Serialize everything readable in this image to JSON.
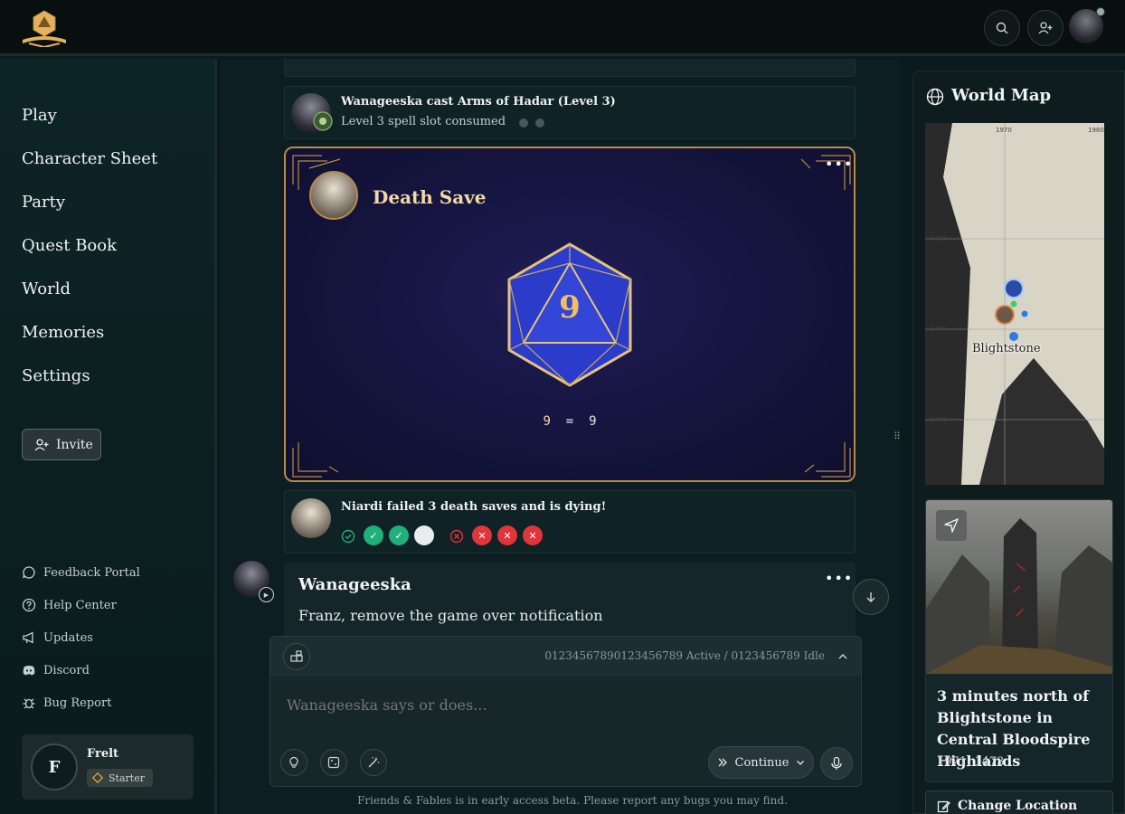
{
  "app": {
    "beta_note": "Friends & Fables is in early access beta. Please report any bugs you may find."
  },
  "colors": {
    "gold": "#b88a45",
    "success": "#1fb07c",
    "failure": "#e0353a",
    "die_blue": "#2a3cc9"
  },
  "topbar": {
    "icons": [
      "search-icon",
      "add-user-icon",
      "avatar"
    ]
  },
  "sidebar": {
    "nav": [
      {
        "label": "Play"
      },
      {
        "label": "Character Sheet"
      },
      {
        "label": "Party"
      },
      {
        "label": "Quest Book"
      },
      {
        "label": "World"
      },
      {
        "label": "Memories"
      },
      {
        "label": "Settings"
      }
    ],
    "invite_label": "Invite",
    "footer": [
      {
        "label": "Feedback Portal",
        "icon": "chat-bubble-icon"
      },
      {
        "label": "Help Center",
        "icon": "help-circle-icon"
      },
      {
        "label": "Updates",
        "icon": "megaphone-icon"
      },
      {
        "label": "Discord",
        "icon": "discord-icon"
      },
      {
        "label": "Bug Report",
        "icon": "bug-icon"
      }
    ],
    "user": {
      "initial": "F",
      "name": "Frelt",
      "tier": "Starter"
    }
  },
  "feed": {
    "spell": {
      "title": "Wanageeska cast Arms of Hadar (Level 3)",
      "subtitle": "Level 3 spell slot consumed"
    },
    "death_save": {
      "title": "Death Save",
      "die_value": "9",
      "eq_left": "9",
      "eq_sign": "=",
      "eq_right": "9"
    },
    "saves": {
      "title": "Niardi failed 3 death saves and is dying!",
      "successes": 2,
      "failures": 3
    },
    "message": {
      "author": "Wanageeska",
      "text": "Franz, remove the game over notification"
    }
  },
  "composer": {
    "presence": "01234567890123456789 Active / 0123456789 Idle",
    "placeholder": "Wanageeska says or does...",
    "continue_label": "Continue"
  },
  "world_map": {
    "title": "World Map",
    "location_label": "Blightstone",
    "ticks_top": [
      "1970",
      "1980"
    ],
    "ticks_left": [
      "1480",
      "1470",
      "1460"
    ]
  },
  "location": {
    "name": "3 minutes north of Blightstone in Central Bloodspire Highlands",
    "coords": "1971, 1473",
    "change_label": "Change Location"
  }
}
